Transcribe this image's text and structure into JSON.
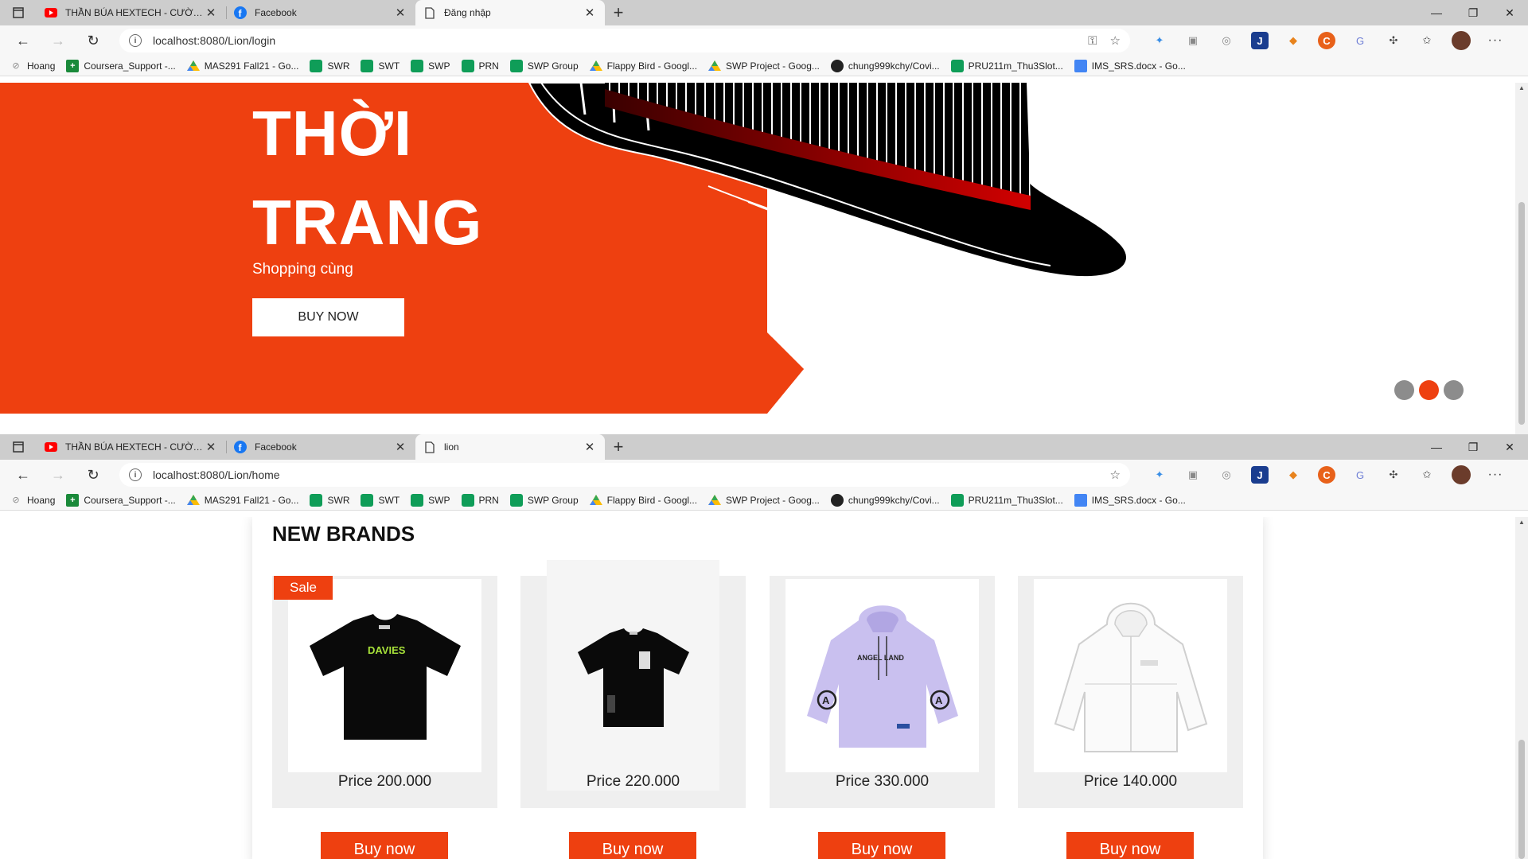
{
  "window1": {
    "tabs": [
      {
        "title": "THẦN BÚA HEXTECH - CƯỜNG ĐÔ LA",
        "icon": "youtube-icon"
      },
      {
        "title": "Facebook",
        "icon": "facebook-icon"
      },
      {
        "title": "Đăng nhập",
        "icon": "page-icon",
        "active": true
      }
    ],
    "url": "localhost:8080/Lion/login",
    "hero": {
      "title_line1": "THỜI",
      "title_line2": "TRANG",
      "subtitle": "Shopping cùng",
      "button": "BUY NOW"
    },
    "carousel": {
      "count": 3,
      "active": 1
    }
  },
  "window2": {
    "tabs": [
      {
        "title": "THẦN BÚA HEXTECH - CƯỜNG ĐÔ LA",
        "icon": "youtube-icon"
      },
      {
        "title": "Facebook",
        "icon": "facebook-icon"
      },
      {
        "title": "lion",
        "icon": "page-icon",
        "active": true
      }
    ],
    "url": "localhost:8080/Lion/home",
    "section_title": "NEW BRANDS",
    "products": [
      {
        "price": "Price 200.000",
        "badge": "Sale",
        "button": "Buy now",
        "image": "black-tshirt-davies"
      },
      {
        "price": "Price 220.000",
        "button": "Buy now",
        "image": "black-tshirt-print"
      },
      {
        "price": "Price 330.000",
        "button": "Buy now",
        "image": "lavender-hoodie"
      },
      {
        "price": "Price 140.000",
        "button": "Buy now",
        "image": "white-jacket"
      }
    ]
  },
  "bookmarks": [
    {
      "label": "Hoang",
      "icon": "globe-icon"
    },
    {
      "label": "Coursera_Support -...",
      "icon": "sheets-icon"
    },
    {
      "label": "MAS291 Fall21 - Go...",
      "icon": "drive-icon"
    },
    {
      "label": "SWR",
      "icon": "meet-icon"
    },
    {
      "label": "SWT",
      "icon": "meet-icon"
    },
    {
      "label": "SWP",
      "icon": "meet-icon"
    },
    {
      "label": "PRN",
      "icon": "meet-icon"
    },
    {
      "label": "SWP Group",
      "icon": "meet-icon"
    },
    {
      "label": "Flappy Bird - Googl...",
      "icon": "drive-icon"
    },
    {
      "label": "SWP Project - Goog...",
      "icon": "drive-icon"
    },
    {
      "label": "chung999kchy/Covi...",
      "icon": "github-icon"
    },
    {
      "label": "PRU211m_Thu3Slot...",
      "icon": "meet-icon"
    },
    {
      "label": "IMS_SRS.docx - Go...",
      "icon": "docs-icon"
    }
  ],
  "colors": {
    "accent": "#ee4010",
    "dot_inactive": "#8c8c8c",
    "card_bg": "#efefef"
  }
}
